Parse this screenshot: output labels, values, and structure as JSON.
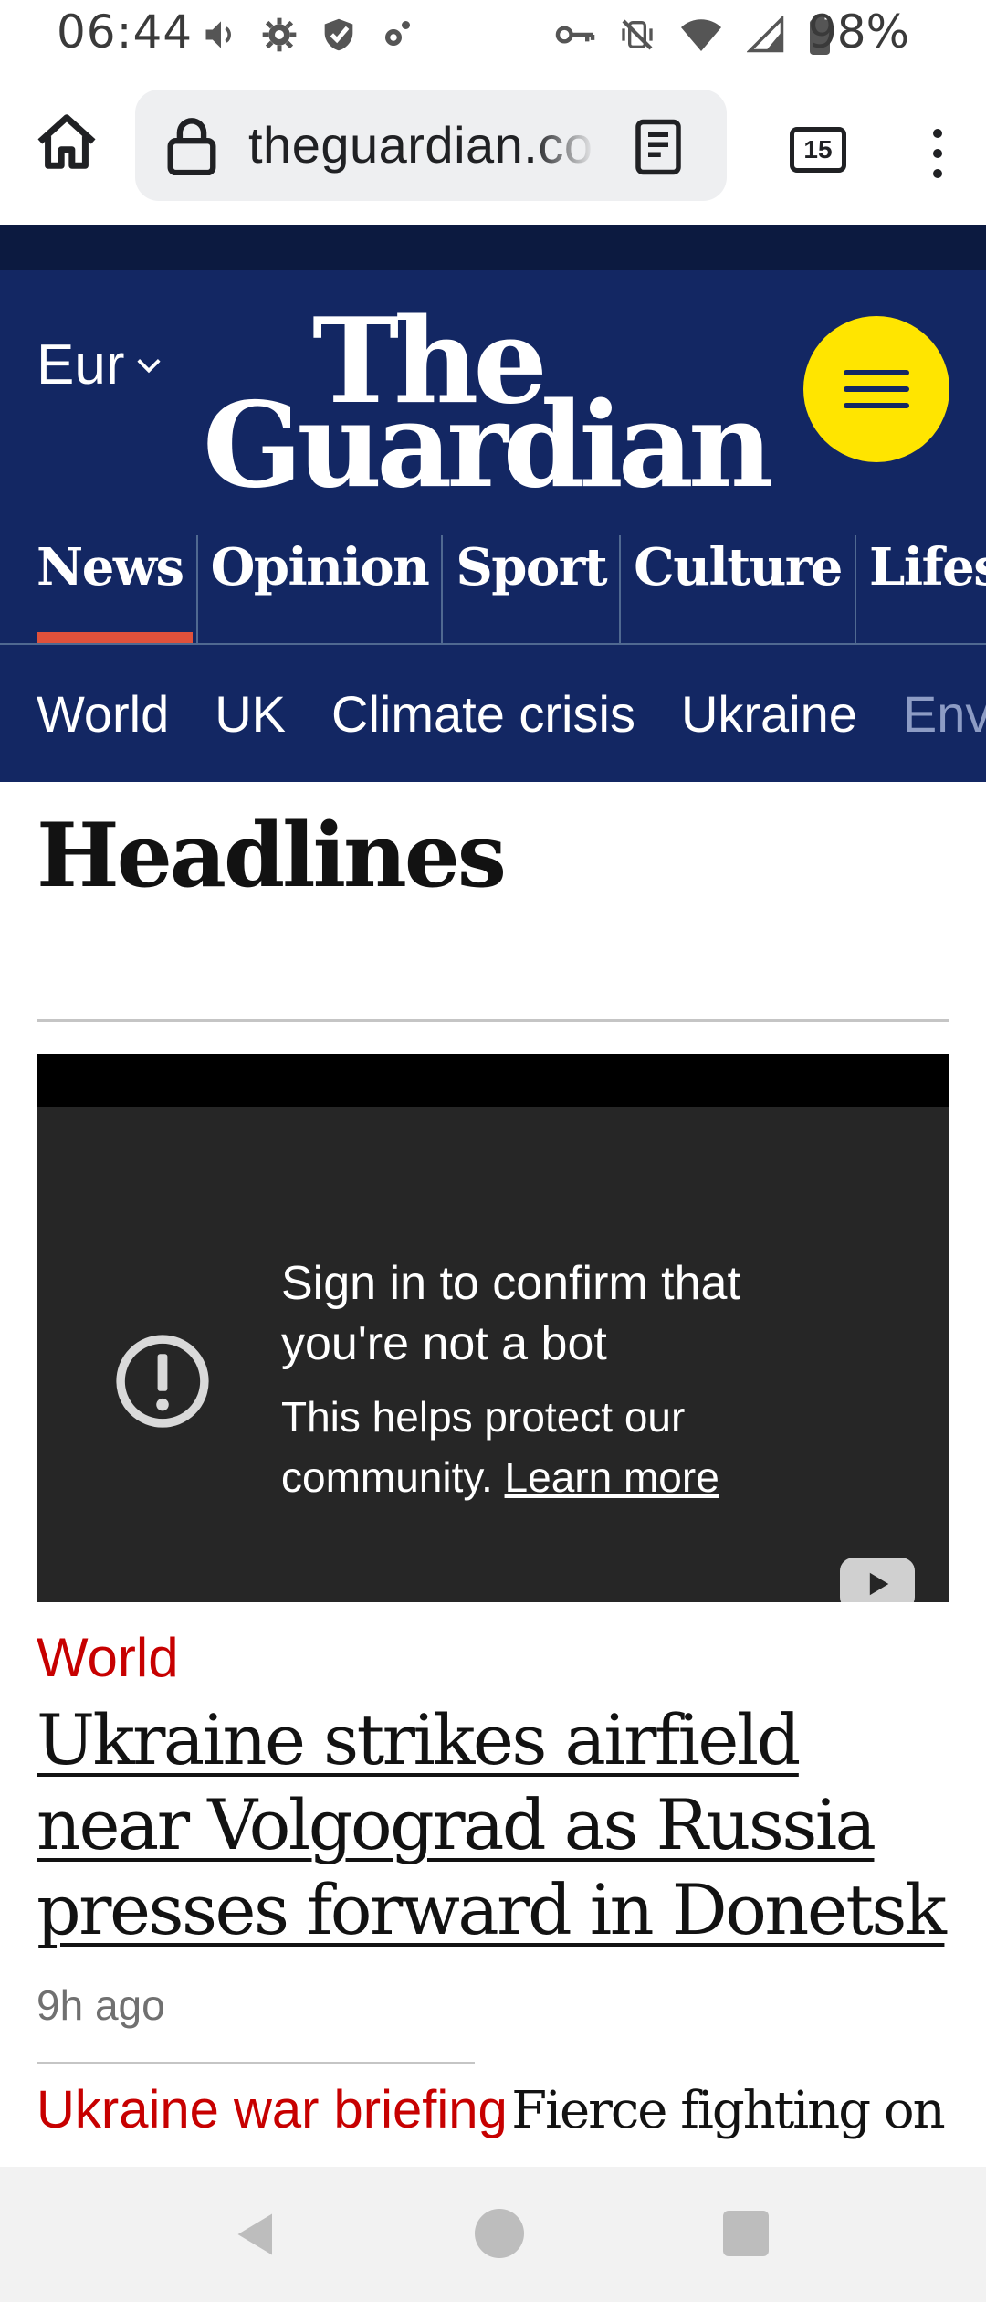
{
  "status_bar": {
    "time": "06:44",
    "battery_percent": "98%",
    "icons": [
      "volume-icon",
      "settings-icon",
      "check-shield-icon",
      "cog-small-icon",
      "vpn-key-icon",
      "vibrate-off-icon",
      "wifi-icon",
      "signal-icon",
      "battery-icon"
    ]
  },
  "browser": {
    "url": "theguardian.com",
    "tab_count": "15"
  },
  "header": {
    "edition": "Eur",
    "logo_line1": "The",
    "logo_line2": "Guardian",
    "pillars": [
      "News",
      "Opinion",
      "Sport",
      "Culture",
      "Lifestyle"
    ],
    "active_pillar": "News",
    "subnav": [
      "World",
      "UK",
      "Climate crisis",
      "Ukraine",
      "Environment"
    ]
  },
  "colors": {
    "brand_navy": "#132763",
    "brand_dark": "#0c1a40",
    "menu_yellow": "#ffe500",
    "news_red": "#c70000",
    "active_underline": "#e0513b"
  },
  "content": {
    "section_title": "Headlines",
    "video": {
      "title": "Sign in to confirm that you're not a bot",
      "subtitle": "This helps protect our community.",
      "link": "Learn more"
    },
    "article": {
      "kicker": "World",
      "headline": "Ukraine strikes airfield near Volgograd as Russia presses forward in Donetsk",
      "timestamp": "9h ago"
    },
    "briefing": {
      "kicker": "Ukraine war briefing",
      "headline": "Fierce fighting on Pokrovsk front as Russia claims gains"
    }
  }
}
